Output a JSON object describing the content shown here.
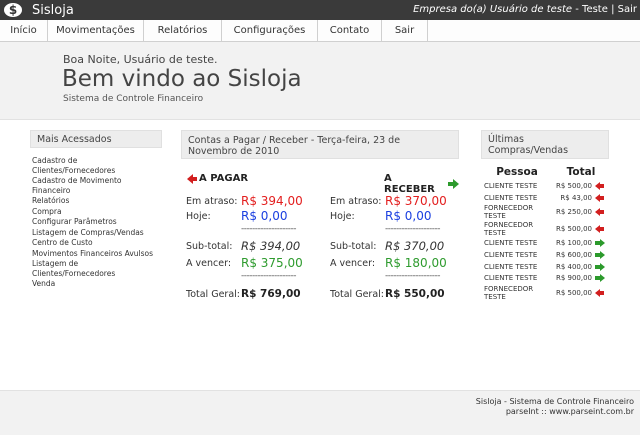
{
  "app": {
    "title": "Sisloja",
    "logo_glyph": "$"
  },
  "topbar": {
    "company": "Empresa do(a) Usuário de teste",
    "sep1": " - ",
    "user": "Teste",
    "sep2": " | ",
    "logout": "Sair"
  },
  "menu": [
    "Início",
    "Movimentações",
    "Relatórios",
    "Configurações",
    "Contato",
    "Sair"
  ],
  "hero": {
    "greeting": "Boa Noite, Usuário de teste.",
    "welcome": "Bem vindo ao Sisloja",
    "subtitle": "Sistema de Controle Financeiro"
  },
  "left": {
    "title": "Mais Acessados",
    "links": [
      "Cadastro de Clientes/Fornecedores",
      "Cadastro de Movimento Financeiro",
      "Relatórios",
      "Compra",
      "Configurar Parâmetros",
      "Listagem de Compras/Vendas",
      "Centro de Custo",
      "Movimentos Financeiros Avulsos",
      "Listagem de Clientes/Fornecedores",
      "Venda"
    ]
  },
  "mid": {
    "title": "Contas a Pagar / Receber - Terça-feira, 23 de Novembro de 2010",
    "pagar": {
      "label": "A PAGAR",
      "em_atraso_label": "Em atraso:",
      "em_atraso": "R$ 394,00",
      "hoje_label": "Hoje:",
      "hoje": "R$ 0,00",
      "subtotal_label": "Sub-total:",
      "subtotal": "R$ 394,00",
      "a_vencer_label": "A vencer:",
      "a_vencer": "R$ 375,00",
      "total_label": "Total Geral:",
      "total": "R$ 769,00"
    },
    "receber": {
      "label": "A RECEBER",
      "em_atraso_label": "Em atraso:",
      "em_atraso": "R$ 370,00",
      "hoje_label": "Hoje:",
      "hoje": "R$ 0,00",
      "subtotal_label": "Sub-total:",
      "subtotal": "R$ 370,00",
      "a_vencer_label": "A vencer:",
      "a_vencer": "R$ 180,00",
      "total_label": "Total Geral:",
      "total": "R$ 550,00"
    },
    "dashes": "--------------------"
  },
  "right": {
    "title": "Últimas Compras/Vendas",
    "col_pessoa": "Pessoa",
    "col_total": "Total",
    "rows": [
      {
        "pessoa": "CLIENTE TESTE",
        "valor": "R$ 500,00",
        "dir": "left"
      },
      {
        "pessoa": "CLIENTE TESTE",
        "valor": "R$ 43,00",
        "dir": "left"
      },
      {
        "pessoa": "FORNECEDOR TESTE",
        "valor": "R$ 250,00",
        "dir": "left"
      },
      {
        "pessoa": "FORNECEDOR TESTE",
        "valor": "R$ 500,00",
        "dir": "left"
      },
      {
        "pessoa": "CLIENTE TESTE",
        "valor": "R$ 100,00",
        "dir": "right"
      },
      {
        "pessoa": "CLIENTE TESTE",
        "valor": "R$ 600,00",
        "dir": "right"
      },
      {
        "pessoa": "CLIENTE TESTE",
        "valor": "R$ 400,00",
        "dir": "right"
      },
      {
        "pessoa": "CLIENTE TESTE",
        "valor": "R$ 900,00",
        "dir": "right"
      },
      {
        "pessoa": "FORNECEDOR TESTE",
        "valor": "R$ 500,00",
        "dir": "left"
      }
    ]
  },
  "colors": {
    "red": "#e31e1e",
    "blue": "#1a3fe0",
    "green": "#2e9b2e",
    "topbar": "#3a3a3a"
  },
  "footer": {
    "line1": "Sisloja - Sistema de Controle Financeiro",
    "line2": "parseInt :: www.parseint.com.br"
  }
}
